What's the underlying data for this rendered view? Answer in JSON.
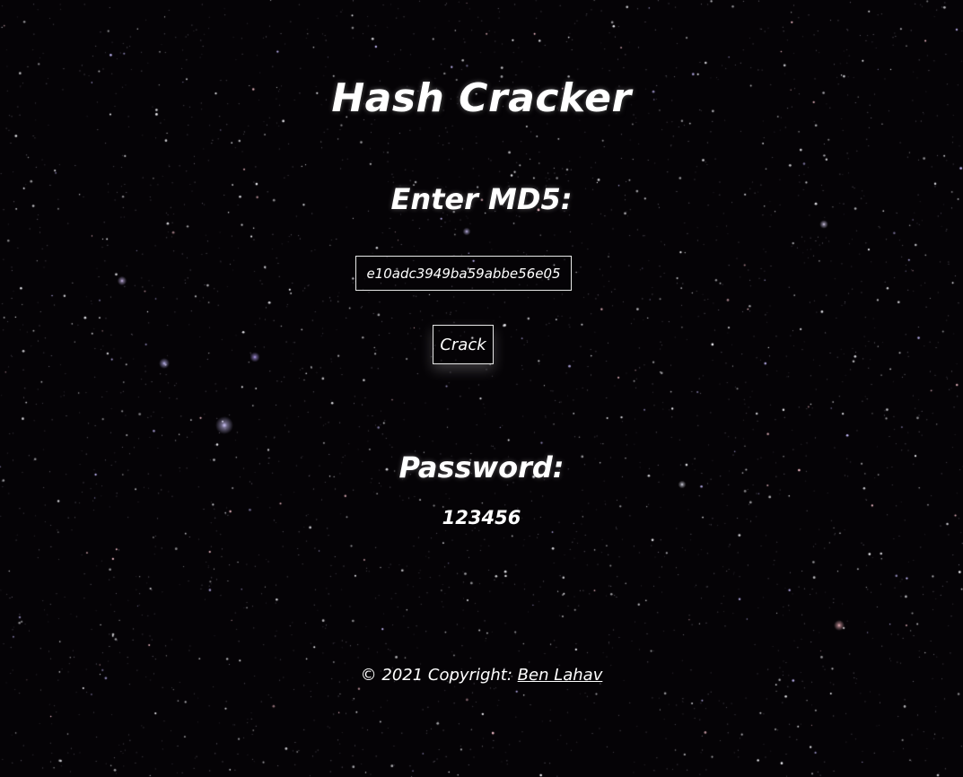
{
  "app": {
    "title": "Hash Cracker"
  },
  "form": {
    "heading": "Enter MD5:",
    "hash_value": "e10adc3949ba59abbe56e05",
    "crack_label": "Crack"
  },
  "result": {
    "heading": "Password:",
    "value": "123456"
  },
  "footer": {
    "copyright": "© 2021 Copyright: ",
    "author_link": "Ben Lahav"
  },
  "theme": {
    "background": "#050306",
    "text": "#ffffff",
    "border": "#e8e8e8"
  }
}
